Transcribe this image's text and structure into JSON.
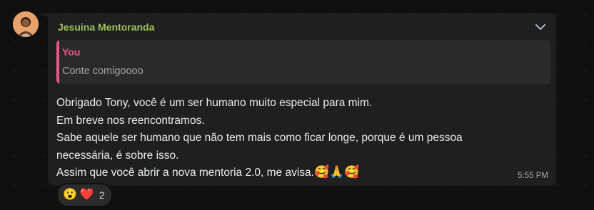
{
  "chat": {
    "sender_name": "Jesuina Mentoranda",
    "quoted": {
      "author": "You",
      "text": "Conte comigoooo"
    },
    "message_lines": [
      "Obrigado Tony,  você é um ser humano muito especial para mim.",
      "Em breve nos reencontramos.",
      "Sabe aquele ser humano que não tem mais como ficar longe,  porque é um pessoa",
      "necessária, é sobre isso.",
      "Assim que você abrir a nova mentoria 2.0, me avisa."
    ],
    "trailing_emojis": [
      "🥰",
      "🙏",
      "🥰"
    ],
    "timestamp": "5:55 PM",
    "reactions": {
      "emojis": [
        "😮",
        "❤️"
      ],
      "count": "2"
    }
  },
  "colors": {
    "sender_name": "#9fc25b",
    "quote_accent": "#e8578a",
    "bubble_bg": "#1f1f1f",
    "background": "#101010"
  },
  "icons": {
    "menu": "chevron-down-icon",
    "avatar": "avatar"
  }
}
